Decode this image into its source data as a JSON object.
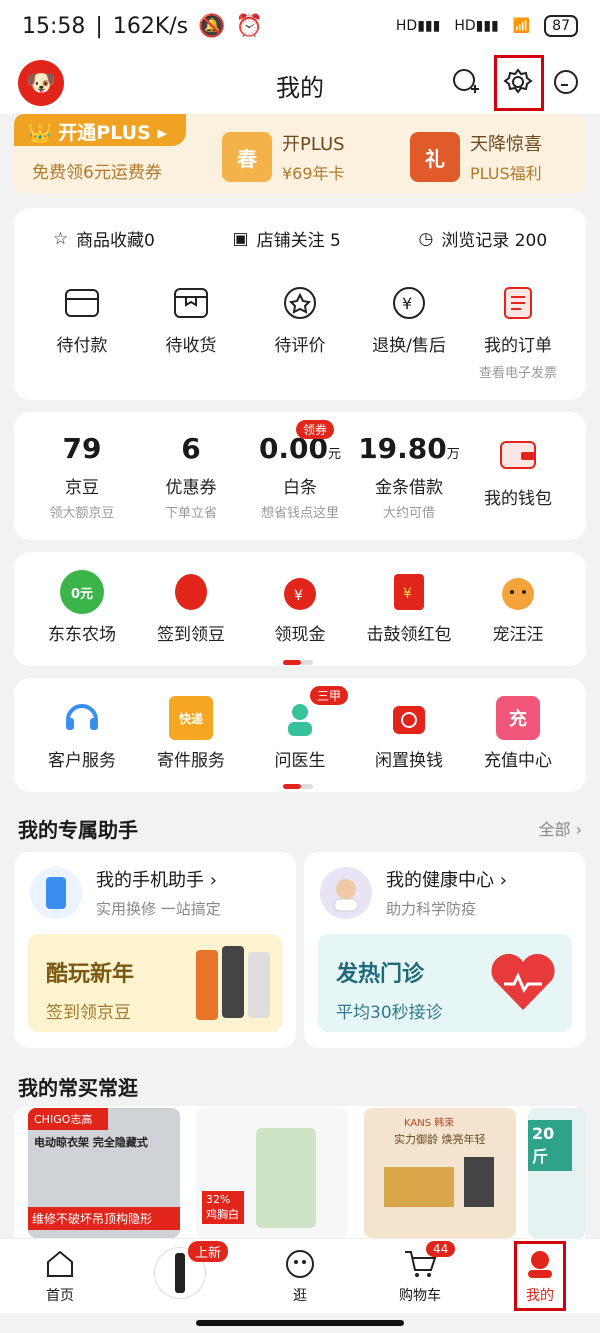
{
  "status_bar": {
    "time": "15:58",
    "speed": "162K/s",
    "net": "HD",
    "battery": "87"
  },
  "header": {
    "title": "我的"
  },
  "plus": {
    "tag": "开通PLUS",
    "sub": "免费领6元运费券",
    "item1": {
      "title": "开PLUS",
      "sub": "¥69年卡"
    },
    "item2": {
      "title": "天降惊喜",
      "sub": "PLUS福利"
    }
  },
  "stats": {
    "fav": "商品收藏0",
    "follow": "店铺关注 5",
    "history": "浏览记录 200"
  },
  "orders": [
    {
      "label": "待付款"
    },
    {
      "label": "待收货"
    },
    {
      "label": "待评价"
    },
    {
      "label": "退换/售后"
    },
    {
      "label": "我的订单",
      "sub": "查看电子发票"
    }
  ],
  "wallet": [
    {
      "value": "79",
      "label": "京豆",
      "sub": "领大额京豆"
    },
    {
      "value": "6",
      "label": "优惠券",
      "sub": "下单立省"
    },
    {
      "value": "0.00",
      "unit": "元",
      "badge": "领券",
      "label": "白条",
      "sub": "想省钱点这里"
    },
    {
      "value": "19.80",
      "unit": "万",
      "label": "金条借款",
      "sub": "大约可借"
    },
    {
      "label": "我的钱包"
    }
  ],
  "games": [
    {
      "label": "东东农场",
      "badge": "0元"
    },
    {
      "label": "签到领豆"
    },
    {
      "label": "领现金"
    },
    {
      "label": "击鼓领红包"
    },
    {
      "label": "宠汪汪"
    }
  ],
  "services": [
    {
      "label": "客户服务"
    },
    {
      "label": "寄件服务",
      "icon_text": "快递"
    },
    {
      "label": "问医生",
      "badge": "三甲"
    },
    {
      "label": "闲置换钱"
    },
    {
      "label": "充值中心",
      "icon_text": "充"
    }
  ],
  "assistant": {
    "title": "我的专属助手",
    "more": "全部",
    "phone": {
      "name": "我的手机助手",
      "desc": "实用换修 一站搞定",
      "b1": "酷玩新年",
      "b2": "签到领京豆"
    },
    "health": {
      "name": "我的健康中心",
      "desc": "助力科学防疫",
      "b1": "发热门诊",
      "b2": "平均30秒接诊"
    }
  },
  "frequent": {
    "title": "我的常买常逛",
    "p1": "维修不破坏吊顶构隐形",
    "p1_brand": "CHIGO志高",
    "p1_sub": "电动晾衣架 完全隐藏式",
    "p2_tag": "32% 鸡胸白",
    "p3_brand": "KANS 韩束",
    "p3_sub": "实力御龄 焕亮年轻",
    "p4": "20斤"
  },
  "tabs": [
    {
      "label": "首页"
    },
    {
      "label": "上新"
    },
    {
      "label": "逛"
    },
    {
      "label": "购物车",
      "badge": "44"
    },
    {
      "label": "我的"
    }
  ],
  "colors": {
    "brand": "#e1251b",
    "gold": "#f0a323"
  }
}
